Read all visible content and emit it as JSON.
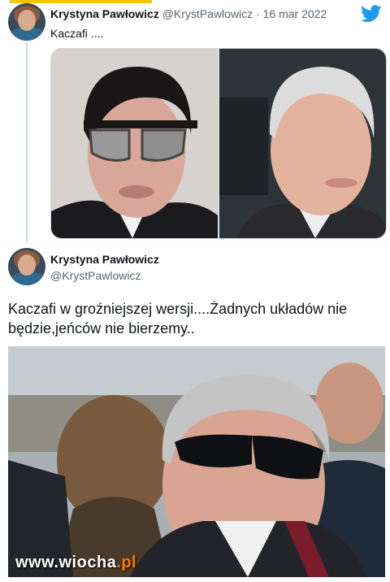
{
  "tweet1": {
    "author_name": "Krystyna Pawłowicz",
    "handle_date": "@KrystPawlowicz · 16 mar 2022",
    "text": "Kaczafi ...."
  },
  "tweet2": {
    "author_name": "Krystyna Pawłowicz",
    "handle": "@KrystPawlowicz",
    "text": "Kaczafi w groźniejszej wersji....Żadnych układów nie będzie,jeńców nie bierzemy.."
  },
  "watermark": {
    "prefix": "www.",
    "brand": "wiocha",
    "suffix": ".pl"
  },
  "colors": {
    "twitter_blue": "#1d9bf0",
    "secondary_text": "#536471",
    "top_accent": "#f5c400"
  },
  "icons": {
    "brand": "twitter-bird-icon"
  }
}
